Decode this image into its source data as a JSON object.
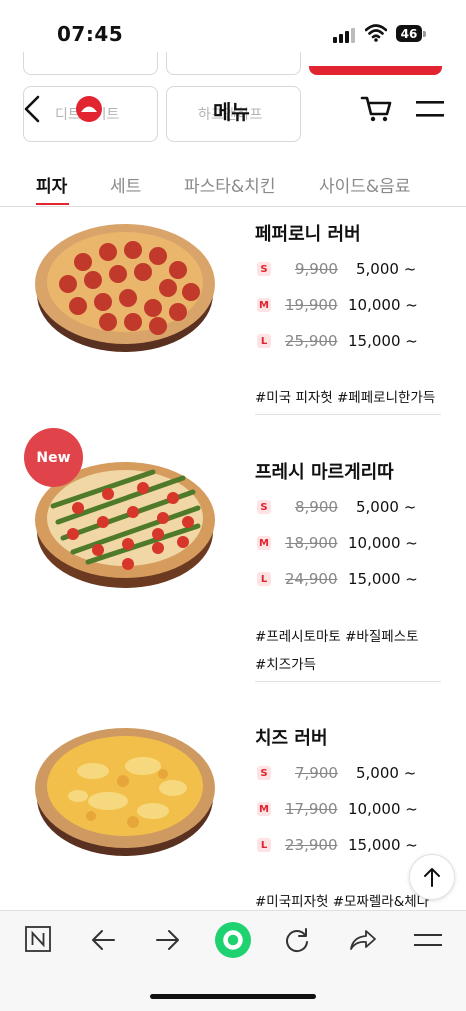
{
  "status_bar": {
    "time": "07:45",
    "battery": "46"
  },
  "header": {
    "title": "메뉴",
    "ghost_left": "디트로이트",
    "ghost_right": "하프앤하프"
  },
  "tabs": [
    {
      "label": "피자",
      "active": true
    },
    {
      "label": "세트",
      "active": false
    },
    {
      "label": "파스타&치킨",
      "active": false
    },
    {
      "label": "사이드&음료",
      "active": false
    }
  ],
  "items": [
    {
      "name": "페퍼로니 러버",
      "is_new": false,
      "sizes": [
        {
          "size": "S",
          "old": "9,900",
          "new": "5,000 ~"
        },
        {
          "size": "M",
          "old": "19,900",
          "new": "10,000 ~"
        },
        {
          "size": "L",
          "old": "25,900",
          "new": "15,000 ~"
        }
      ],
      "tags": [
        "#미국 피자헛 #페페로니한가득"
      ]
    },
    {
      "name": "프레시 마르게리따",
      "is_new": true,
      "sizes": [
        {
          "size": "S",
          "old": "8,900",
          "new": "5,000 ~"
        },
        {
          "size": "M",
          "old": "18,900",
          "new": "10,000 ~"
        },
        {
          "size": "L",
          "old": "24,900",
          "new": "15,000 ~"
        }
      ],
      "tags": [
        "#프레시토마토 #바질페스토",
        "#치즈가득"
      ]
    },
    {
      "name": "치즈 러버",
      "is_new": false,
      "sizes": [
        {
          "size": "S",
          "old": "7,900",
          "new": "5,000 ~"
        },
        {
          "size": "M",
          "old": "17,900",
          "new": "10,000 ~"
        },
        {
          "size": "L",
          "old": "23,900",
          "new": "15,000 ~"
        }
      ],
      "tags": [
        "#미국피자헛 #모짜렐라&체다"
      ]
    }
  ],
  "new_badge": "New",
  "icons": {
    "back": "chevron-left-icon",
    "cart": "cart-icon",
    "menu": "hamburger-icon",
    "scroll_top": "arrow-up-icon"
  },
  "colors": {
    "accent": "#e1242f",
    "new_badge": "#e1434b",
    "go_button": "#1ed36f"
  }
}
